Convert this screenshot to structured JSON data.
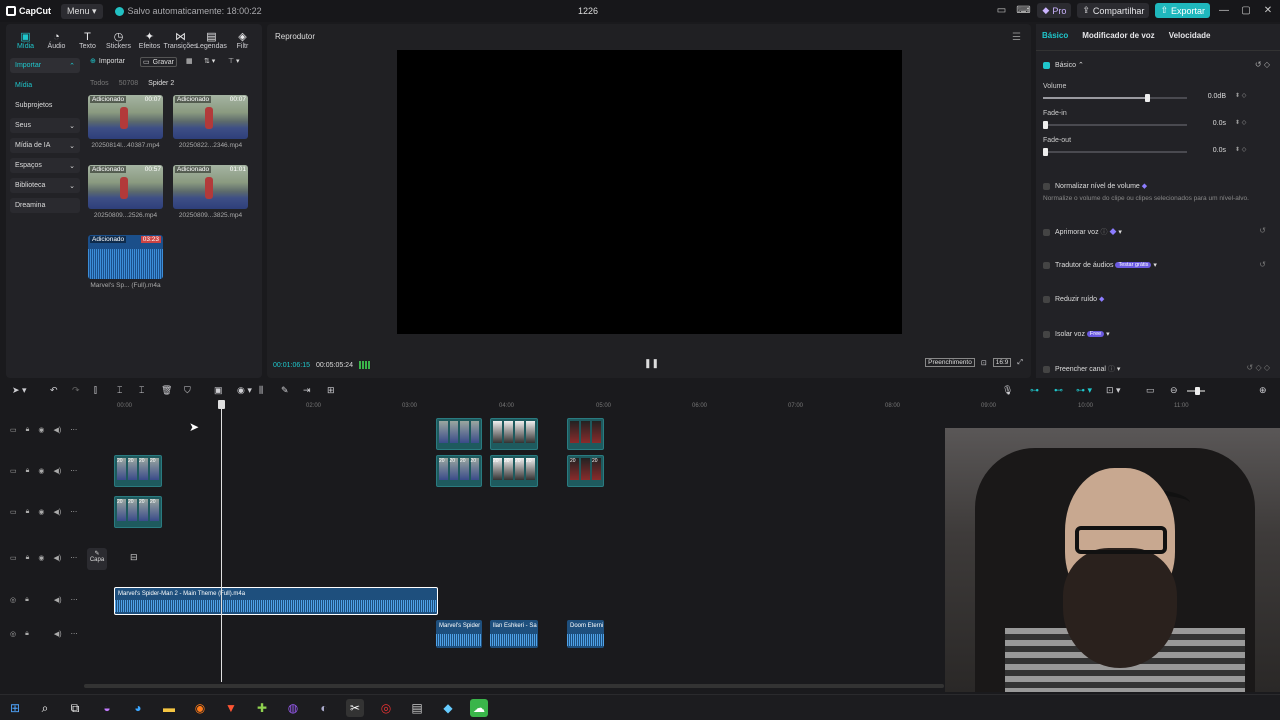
{
  "titlebar": {
    "app_name": "CapCut",
    "menu_label": "Menu",
    "saved_text": "Salvo automaticamente: 18:00:22",
    "project_name": "1226",
    "pro_label": "Pro",
    "share_label": "Compartilhar",
    "export_label": "Exportar"
  },
  "toptabs": [
    {
      "label": "Mídia",
      "icon": "media-icon"
    },
    {
      "label": "Áudio",
      "icon": "audio-icon"
    },
    {
      "label": "Texto",
      "icon": "text-icon"
    },
    {
      "label": "Stickers",
      "icon": "sticker-icon"
    },
    {
      "label": "Efeitos",
      "icon": "effects-icon"
    },
    {
      "label": "Transições",
      "icon": "transitions-icon"
    },
    {
      "label": "Legendas",
      "icon": "captions-icon"
    },
    {
      "label": "Filtr",
      "icon": "filter-icon"
    }
  ],
  "sidenav": [
    {
      "label": "Importar"
    },
    {
      "label": "Mídia"
    },
    {
      "label": "Subprojetos"
    },
    {
      "label": "Seus"
    },
    {
      "label": "Mídia de IA"
    },
    {
      "label": "Espaços"
    },
    {
      "label": "Biblioteca"
    },
    {
      "label": "Dreamina"
    }
  ],
  "media": {
    "import_label": "Importar",
    "record_label": "Gravar",
    "crumbs": [
      "Todos",
      "50708",
      "Spider 2"
    ],
    "items": [
      {
        "tag": "Adicionado",
        "duration": "00:07",
        "name": "20250814l...40387.mp4"
      },
      {
        "tag": "Adicionado",
        "duration": "00:07",
        "name": "20250822...2346.mp4"
      },
      {
        "tag": "Adicionado",
        "duration": "00:57",
        "name": "20250809...2526.mp4"
      },
      {
        "tag": "Adicionado",
        "duration": "01:01",
        "name": "20250809...3825.mp4"
      },
      {
        "tag": "Adicionado",
        "duration": "03:23",
        "name": "Marvel's Sp... (Full).m4a"
      }
    ]
  },
  "player": {
    "title": "Reprodutor",
    "current_time": "00:01:06:15",
    "total_time": "00:05:05:24",
    "fill_label": "Preenchimento",
    "ratio_label": "16:9"
  },
  "rightpanel": {
    "tabs": [
      "Básico",
      "Modificador de voz",
      "Velocidade"
    ],
    "section": "Básico",
    "volume_label": "Volume",
    "volume_value": "0.0dB",
    "volume_level": 0.72,
    "fadein_label": "Fade-in",
    "fadein_value": "0.0s",
    "fadeout_label": "Fade-out",
    "fadeout_value": "0.0s",
    "normalize_label": "Normalizar nível de volume",
    "normalize_desc": "Normalize o volume do clipe ou clipes selecionados para um nível-alvo.",
    "enhance_label": "Aprimorar voz",
    "translate_label": "Tradutor de áudios",
    "translate_badge": "Testar grátis",
    "denoise_label": "Reduzir ruído",
    "isolate_label": "Isolar voz",
    "isolate_badge": "Free",
    "fill_channel_label": "Preencher canal"
  },
  "timeline": {
    "ruler": [
      "00:00",
      "02:00",
      "03:00",
      "04:00",
      "05:00",
      "06:00",
      "07:00",
      "08:00",
      "09:00",
      "10:00",
      "11:00"
    ],
    "cover_label": "Capa",
    "audio_main": "Marvel's Spider-Man 2 - Main Theme (Full).m4a",
    "audio_a": "Marvel's Spider",
    "audio_b": "llan Eshkeri - Sa",
    "audio_c": "Doom Eterni",
    "clip_cells": [
      "20",
      "20",
      "20",
      "20"
    ]
  },
  "colors": {
    "accent": "#1fc7cc",
    "background": "#1a1a1d"
  }
}
